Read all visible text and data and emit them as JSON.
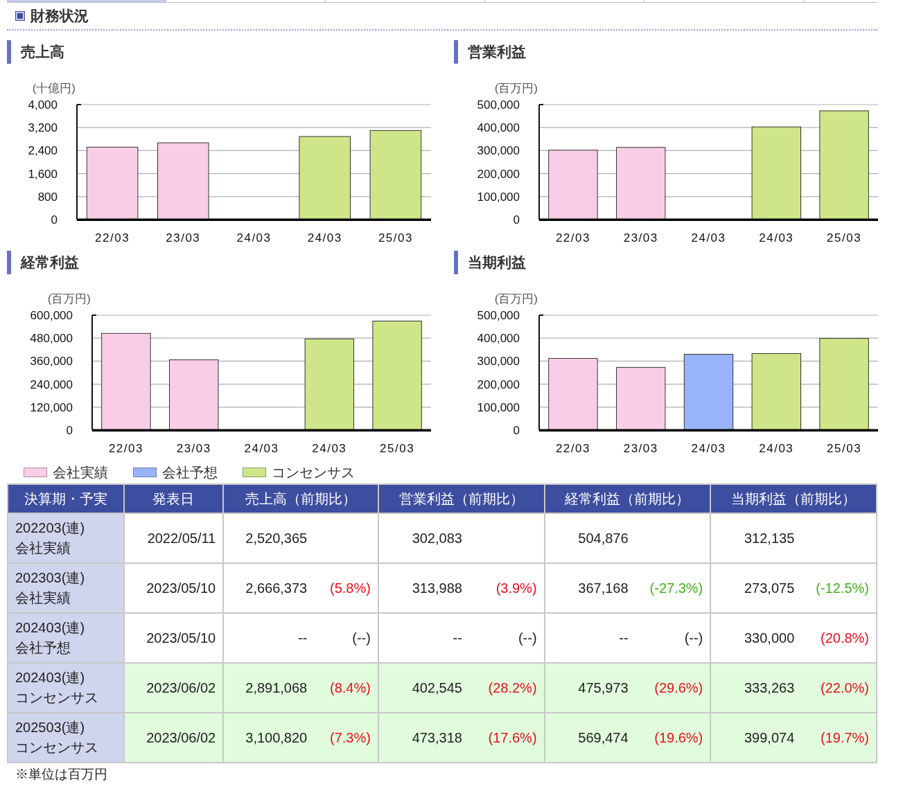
{
  "tabs": [
    {
      "selected": true
    },
    {
      "selected": false
    },
    {
      "selected": false
    },
    {
      "selected": false
    },
    {
      "selected": false
    }
  ],
  "section": {
    "title": "財務状況"
  },
  "charts": [
    {
      "title": "売上高",
      "chart_data": {
        "type": "bar",
        "grid": true,
        "ylabel": "(十億円)",
        "categories": [
          "22/03",
          "23/03",
          "24/03",
          "24/03",
          "25/03"
        ],
        "ylim": [
          0,
          4000
        ],
        "yticks": [
          {
            "value": 0,
            "label": "0"
          },
          {
            "value": 800,
            "label": "800"
          },
          {
            "value": 1600,
            "label": "1,600"
          },
          {
            "value": 2400,
            "label": "2,400"
          },
          {
            "value": 3200,
            "label": "3,200"
          },
          {
            "value": 4000,
            "label": "4,000"
          }
        ],
        "series": [
          {
            "color": "#f9cde6",
            "values": [
              2520,
              2670,
              null,
              null,
              null
            ]
          },
          {
            "color": "#cee688",
            "values": [
              null,
              null,
              null,
              2890,
              3100
            ]
          }
        ]
      }
    },
    {
      "title": "営業利益",
      "chart_data": {
        "type": "bar",
        "grid": true,
        "ylabel": "(百万円)",
        "categories": [
          "22/03",
          "23/03",
          "24/03",
          "24/03",
          "25/03"
        ],
        "ylim": [
          0,
          500000
        ],
        "yticks": [
          {
            "value": 0,
            "label": "0"
          },
          {
            "value": 100000,
            "label": "100,000"
          },
          {
            "value": 200000,
            "label": "200,000"
          },
          {
            "value": 300000,
            "label": "300,000"
          },
          {
            "value": 400000,
            "label": "400,000"
          },
          {
            "value": 500000,
            "label": "500,000"
          }
        ],
        "series": [
          {
            "color": "#f9cde6",
            "values": [
              302000,
              314000,
              null,
              null,
              null
            ]
          },
          {
            "color": "#cee688",
            "values": [
              null,
              null,
              null,
              403000,
              473000
            ]
          }
        ]
      }
    },
    {
      "title": "経常利益",
      "chart_data": {
        "type": "bar",
        "grid": true,
        "ylabel": "(百万円)",
        "categories": [
          "22/03",
          "23/03",
          "24/03",
          "24/03",
          "25/03"
        ],
        "ylim": [
          0,
          600000
        ],
        "yticks": [
          {
            "value": 0,
            "label": "0"
          },
          {
            "value": 120000,
            "label": "120,000"
          },
          {
            "value": 240000,
            "label": "240,000"
          },
          {
            "value": 360000,
            "label": "360,000"
          },
          {
            "value": 480000,
            "label": "480,000"
          },
          {
            "value": 600000,
            "label": "600,000"
          }
        ],
        "series": [
          {
            "color": "#f9cde6",
            "values": [
              505000,
              367000,
              null,
              null,
              null
            ]
          },
          {
            "color": "#cee688",
            "values": [
              null,
              null,
              null,
              476000,
              569000
            ]
          }
        ]
      }
    },
    {
      "title": "当期利益",
      "chart_data": {
        "type": "bar",
        "grid": true,
        "ylabel": "(百万円)",
        "categories": [
          "22/03",
          "23/03",
          "24/03",
          "24/03",
          "25/03"
        ],
        "ylim": [
          0,
          500000
        ],
        "yticks": [
          {
            "value": 0,
            "label": "0"
          },
          {
            "value": 100000,
            "label": "100,000"
          },
          {
            "value": 200000,
            "label": "200,000"
          },
          {
            "value": 300000,
            "label": "300,000"
          },
          {
            "value": 400000,
            "label": "400,000"
          },
          {
            "value": 500000,
            "label": "500,000"
          }
        ],
        "series": [
          {
            "color": "#f9cde6",
            "values": [
              312000,
              273000,
              null,
              null,
              null
            ]
          },
          {
            "color": "#99b3fb",
            "values": [
              null,
              null,
              330000,
              null,
              null
            ]
          },
          {
            "color": "#cee688",
            "values": [
              null,
              null,
              null,
              333000,
              399000
            ]
          }
        ]
      }
    }
  ],
  "legend": [
    {
      "label": "会社実績",
      "color": "#f9cde6"
    },
    {
      "label": "会社予想",
      "color": "#99b3fb"
    },
    {
      "label": "コンセンサス",
      "color": "#cee688"
    }
  ],
  "table": {
    "columns": [
      "決算期・予実",
      "発表日",
      "売上高（前期比）",
      "営業利益（前期比）",
      "経常利益（前期比）",
      "当期利益（前期比）"
    ],
    "rows": [
      {
        "kind": "actual",
        "cells": [
          {
            "period": "202203(連)",
            "type": "会社実績"
          },
          {
            "value": "2022/05/11"
          },
          {
            "value": "2,520,365"
          },
          {
            "value": "302,083"
          },
          {
            "value": "504,876"
          },
          {
            "value": "312,135"
          }
        ]
      },
      {
        "kind": "actual",
        "cells": [
          {
            "period": "202303(連)",
            "type": "会社実績"
          },
          {
            "value": "2023/05/10"
          },
          {
            "value": "2,666,373",
            "change": "(5.8%)",
            "color": "#e8111c"
          },
          {
            "value": "313,988",
            "change": "(3.9%)",
            "color": "#e8111c"
          },
          {
            "value": "367,168",
            "change": "(-27.3%)",
            "color": "#41b11b"
          },
          {
            "value": "273,075",
            "change": "(-12.5%)",
            "color": "#41b11b"
          }
        ]
      },
      {
        "kind": "forecast",
        "cells": [
          {
            "period": "202403(連)",
            "type": "会社予想"
          },
          {
            "value": "2023/05/10"
          },
          {
            "value": "--",
            "change": "(--)",
            "color": "#222222"
          },
          {
            "value": "--",
            "change": "(--)",
            "color": "#222222"
          },
          {
            "value": "--",
            "change": "(--)",
            "color": "#222222"
          },
          {
            "value": "330,000",
            "change": "(20.8%)",
            "color": "#e8111c"
          }
        ]
      },
      {
        "kind": "consensus",
        "cells": [
          {
            "period": "202403(連)",
            "type": "コンセンサス"
          },
          {
            "value": "2023/06/02"
          },
          {
            "value": "2,891,068",
            "change": "(8.4%)",
            "color": "#e8111c"
          },
          {
            "value": "402,545",
            "change": "(28.2%)",
            "color": "#e8111c"
          },
          {
            "value": "475,973",
            "change": "(29.6%)",
            "color": "#e8111c"
          },
          {
            "value": "333,263",
            "change": "(22.0%)",
            "color": "#e8111c"
          }
        ]
      },
      {
        "kind": "consensus",
        "cells": [
          {
            "period": "202503(連)",
            "type": "コンセンサス"
          },
          {
            "value": "2023/06/02"
          },
          {
            "value": "3,100,820",
            "change": "(7.3%)",
            "color": "#e8111c"
          },
          {
            "value": "473,318",
            "change": "(17.6%)",
            "color": "#e8111c"
          },
          {
            "value": "569,474",
            "change": "(19.6%)",
            "color": "#e8111c"
          },
          {
            "value": "399,074",
            "change": "(19.7%)",
            "color": "#e8111c"
          }
        ]
      }
    ]
  },
  "footnote": "※単位は百万円"
}
